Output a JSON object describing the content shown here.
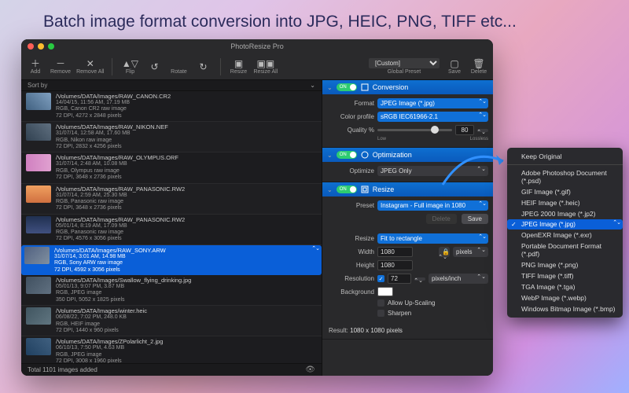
{
  "caption": "Batch image format conversion into JPG, HEIC, PNG, TIFF etc...",
  "window": {
    "title": "PhotoResize Pro"
  },
  "toolbar": {
    "add": "Add",
    "remove": "Remove",
    "removeAll": "Remove All",
    "flip": "Flip",
    "rotate": "Rotate",
    "resize": "Resize",
    "resizeAll": "Resize All",
    "globalPreset": "Global Preset",
    "presetValue": "[Custom]",
    "save": "Save",
    "delete": "Delete"
  },
  "sortby": "Sort by",
  "files": [
    {
      "path": "/Volumes/DATA/Images/RAW_CANON.CR2",
      "date": "14/04/15, 11:56 AM, 17.19 MB",
      "fmt": "RGB, Canon CR2 raw image",
      "dim": "72 DPI, 4272 x 2848 pixels"
    },
    {
      "path": "/Volumes/DATA/Images/RAW_NIKON.NEF",
      "date": "31/07/14, 12:58 AM, 17.60 MB",
      "fmt": "RGB, Nikon raw image",
      "dim": "72 DPI, 2832 x 4256 pixels"
    },
    {
      "path": "/Volumes/DATA/Images/RAW_OLYMPUS.ORF",
      "date": "31/07/14, 2:48 AM, 10.08 MB",
      "fmt": "RGB, Olympus raw image",
      "dim": "72 DPI, 3648 x 2736 pixels"
    },
    {
      "path": "/Volumes/DATA/Images/RAW_PANASONIC.RW2",
      "date": "31/07/14, 2:59 AM, 25.30 MB",
      "fmt": "RGB, Panasonic raw image",
      "dim": "72 DPI, 3648 x 2736 pixels"
    },
    {
      "path": "/Volumes/DATA/Images/RAW_PANASONIC.RW2",
      "date": "05/01/14, 8:19 AM, 17.09 MB",
      "fmt": "RGB, Panasonic raw image",
      "dim": "72 DPI, 4576 x 3056 pixels"
    },
    {
      "path": "/Volumes/DATA/Images/RAW_SONY.ARW",
      "date": "31/07/14, 3:01 AM, 14.98 MB",
      "fmt": "RGB, Sony ARW raw image",
      "dim": "72 DPI, 4592 x 3056 pixels"
    },
    {
      "path": "/Volumes/DATA/Images/Swallow_flying_drinking.jpg",
      "date": "05/01/13, 9:07 PM, 3.87 MB",
      "fmt": "RGB, JPEG image",
      "dim": "350 DPI, 5052 x 1825 pixels"
    },
    {
      "path": "/Volumes/DATA/Images/winter.heic",
      "date": "06/08/22, 7:02 PM, 248.0 KB",
      "fmt": "RGB, HEIF image",
      "dim": "72 DPI, 1440 x 960 pixels"
    },
    {
      "path": "/Volumes/DATA/Images/ZPolarlicht_2.jpg",
      "date": "06/10/13, 7:50 PM, 4.63 MB",
      "fmt": "RGB, JPEG image",
      "dim": "72 DPI, 3008 x 1960 pixels"
    }
  ],
  "status": "Total 1101 images added",
  "panel": {
    "conversion": {
      "title": "Conversion",
      "on": "ON",
      "formatLbl": "Format",
      "format": "JPEG Image (*.jpg)",
      "profileLbl": "Color profile",
      "profile": "sRGB IEC61966-2.1",
      "qualityLbl": "Quality %",
      "quality": "80",
      "low": "Low",
      "lossless": "Lossless"
    },
    "optimization": {
      "title": "Optimization",
      "on": "ON",
      "optimizeLbl": "Optimize",
      "optimize": "JPEG Only"
    },
    "resize": {
      "title": "Resize",
      "on": "ON",
      "presetLbl": "Preset",
      "preset": "Instagram - Full image in 1080",
      "delete": "Delete",
      "save": "Save",
      "resizeLbl": "Resize",
      "resizeMode": "Fit to rectangle",
      "widthLbl": "Width",
      "width": "1080",
      "heightLbl": "Height",
      "height": "1080",
      "unit": "pixels",
      "resLbl": "Resolution",
      "res": "72",
      "resUnit": "pixels/inch",
      "bgLbl": "Background",
      "allowUp": "Allow Up-Scaling",
      "sharpen": "Sharpen",
      "resultLbl": "Result:",
      "result": "1080 x 1080 pixels"
    }
  },
  "dropdown": {
    "keep": "Keep Original",
    "items": [
      "Adobe Photoshop Document (*.psd)",
      "GIF Image (*.gif)",
      "HEIF Image (*.heic)",
      "JPEG 2000 Image (*.jp2)",
      "JPEG Image (*.jpg)",
      "OpenEXR Image (*.exr)",
      "Portable Document Format (*.pdf)",
      "PNG Image (*.png)",
      "TIFF Image (*.tiff)",
      "TGA Image (*.tga)",
      "WebP Image (*.webp)",
      "Windows Bitmap Image (*.bmp)"
    ]
  }
}
